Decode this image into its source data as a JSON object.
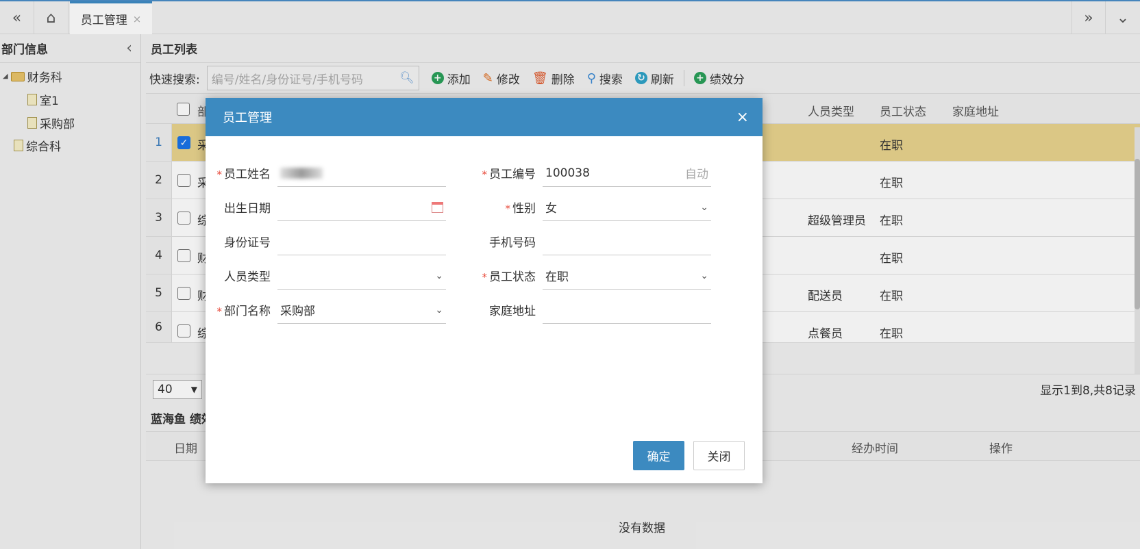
{
  "topbar": {
    "tab_label": "员工管理",
    "tab_close": "×",
    "left_chevron": "«",
    "home_icon": "⌂",
    "right_chevron": "»",
    "menu_chevron": "⌄"
  },
  "left": {
    "title": "部门信息",
    "collapse": "‹",
    "tree": [
      {
        "label": "财务科"
      },
      {
        "label": "室1"
      },
      {
        "label": "采购部"
      },
      {
        "label": "综合科"
      }
    ]
  },
  "list": {
    "title": "员工列表",
    "search_label": "快速搜索:",
    "search_placeholder": "编号/姓名/身份证号/手机号码",
    "buttons": {
      "add": "添加",
      "edit": "修改",
      "delete": "删除",
      "search": "搜索",
      "refresh": "刷新",
      "score": "绩效分"
    },
    "columns": {
      "dept": "部",
      "type": "人员类型",
      "status": "员工状态",
      "address": "家庭地址"
    },
    "rows": [
      {
        "num": "1",
        "dept": "采",
        "type": "",
        "status": "在职",
        "checked": true
      },
      {
        "num": "2",
        "dept": "采",
        "type": "",
        "status": "在职",
        "checked": false
      },
      {
        "num": "3",
        "dept": "综",
        "type": "超级管理员",
        "status": "在职",
        "checked": false
      },
      {
        "num": "4",
        "dept": "财",
        "type": "",
        "status": "在职",
        "checked": false
      },
      {
        "num": "5",
        "dept": "财",
        "type": "配送员",
        "status": "在职",
        "checked": false
      },
      {
        "num": "6",
        "dept": "综",
        "type": "点餐员",
        "status": "在职",
        "checked": false
      }
    ],
    "page_size": "40",
    "pager_info": "显示1到8,共8记录"
  },
  "sub": {
    "title": "蓝海鱼 绩效",
    "columns": {
      "date": "日期",
      "time": "经办时间",
      "action": "操作"
    },
    "empty": "没有数据"
  },
  "modal": {
    "title": "员工管理",
    "close": "×",
    "fields": {
      "name_label": "员工姓名",
      "code_label": "员工编号",
      "code_value": "100038",
      "code_hint": "自动",
      "birth_label": "出生日期",
      "gender_label": "性别",
      "gender_value": "女",
      "id_label": "身份证号",
      "phone_label": "手机号码",
      "type_label": "人员类型",
      "status_label": "员工状态",
      "status_value": "在职",
      "dept_label": "部门名称",
      "dept_value": "采购部",
      "address_label": "家庭地址"
    },
    "ok": "确定",
    "cancel": "关闭"
  }
}
